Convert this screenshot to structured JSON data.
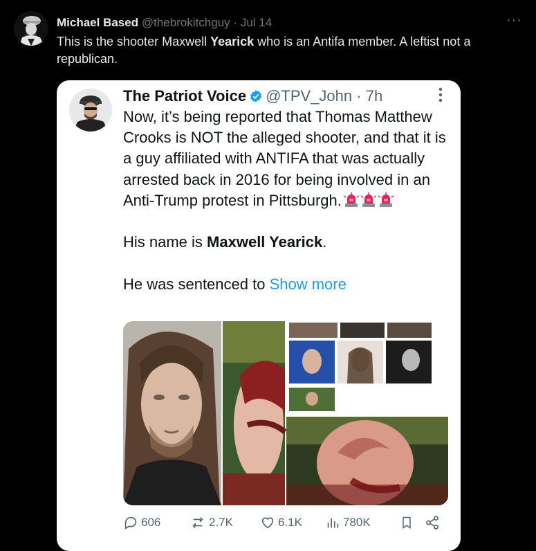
{
  "post": {
    "author_name": "Michael Based",
    "author_handle": "@thebrokitchguy",
    "separator": "·",
    "date": "Jul 14",
    "more_label": "···",
    "text_before": "This is the shooter Maxwell ",
    "text_bold": "Yearick",
    "text_after": " who is an Antifa member. A leftist not a republican."
  },
  "quoted": {
    "author_name": "The Patriot Voice",
    "author_handle": "@TPV_John",
    "separator": "·",
    "time": "7h",
    "paragraph1": "Now, it’s being reported that Thomas Matthew Crooks is NOT the alleged shooter, and that it is a guy affiliated with ANTIFA that was actually arrested back in 2016 for being involved in an Anti-Trump protest in Pittsburgh.",
    "paragraph2_before": "His name is ",
    "paragraph2_bold": "Maxwell Yearick",
    "paragraph2_after": ".",
    "paragraph3": "He was sentenced to ",
    "show_more": "Show more",
    "emoji": "police-car-light-icon",
    "accent_color": "#1d9bf0"
  },
  "actions": {
    "replies": "606",
    "reposts": "2.7K",
    "likes": "6.1K",
    "views": "780K"
  },
  "colors": {
    "background": "#000000",
    "card": "#ffffff",
    "muted": "#71767b",
    "accent": "#1d9bf0"
  }
}
